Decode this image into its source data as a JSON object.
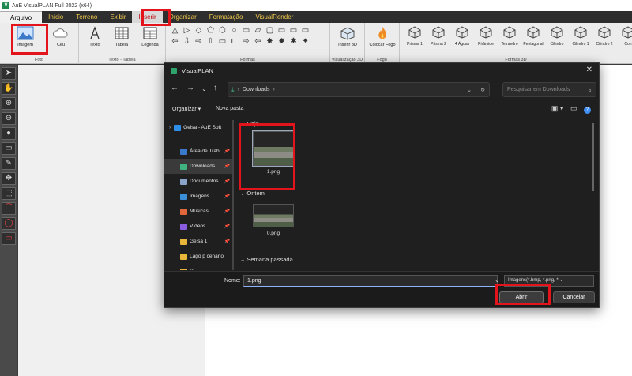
{
  "app": {
    "title": "AuE VisualPLAN Full 2022 (x64)"
  },
  "menu": [
    "Arquivo",
    "Início",
    "Terreno",
    "Exibir",
    "Inserir",
    "Organizar",
    "Formatação",
    "VisualRender"
  ],
  "ribbon": {
    "foto": {
      "imagem": "Imagem",
      "ceu": "Céu",
      "group": "Foto"
    },
    "texto_tabela": {
      "texto": "Texto",
      "tabela": "Tabela",
      "legenda": "Legenda",
      "group": "Texto - Tabela"
    },
    "formas": {
      "group": "Formas",
      "shapes": [
        "△",
        "▷",
        "◇",
        "⬠",
        "⬡",
        "○",
        "▭",
        "▱",
        "▢",
        "▭",
        "▭",
        "▭",
        "⇦",
        "⇩",
        "⇨",
        "⇧",
        "▭",
        "⊏",
        "⇨",
        "⇦",
        "✸",
        "✹",
        "✱",
        "✦"
      ]
    },
    "visualizacao3d": {
      "label": "Inserir 3D",
      "group": "Visualização 3D"
    },
    "fogo": {
      "label": "Colocar Fogo",
      "group": "Fogo"
    },
    "formas3d": {
      "group": "Formas 3D",
      "items": [
        "Prisma 1",
        "Prisma 2",
        "4 Águas",
        "Pirâmide",
        "Tetraedro",
        "Pentagonal",
        "Cilindro",
        "Cilindro 1",
        "Cilindro 2",
        "Con"
      ]
    }
  },
  "dialog": {
    "title": "VisualPLAN",
    "breadcrumb": "Downloads",
    "search_placeholder": "Pesquisar em Downloads",
    "organizar": "Organizar",
    "nova_pasta": "Nova pasta",
    "sidebar": [
      {
        "label": "Geisa - AuE Soft",
        "color": "#2f8fe8",
        "pinned": false,
        "top": true
      },
      {
        "label": "Área de Trab",
        "color": "#3a78c8",
        "pinned": true
      },
      {
        "label": "Downloads",
        "color": "#3fb27f",
        "pinned": true,
        "selected": true
      },
      {
        "label": "Documentos",
        "color": "#8aa3c8",
        "pinned": true
      },
      {
        "label": "Imagens",
        "color": "#3a8fd8",
        "pinned": true
      },
      {
        "label": "Músicas",
        "color": "#e0663c",
        "pinned": true
      },
      {
        "label": "Vídeos",
        "color": "#8a5ce0",
        "pinned": true
      },
      {
        "label": "Geisa 1",
        "color": "#e8b73a",
        "pinned": true
      },
      {
        "label": "Lago p cenario",
        "color": "#e8b73a",
        "pinned": false
      },
      {
        "label": "C...",
        "color": "#e8b73a",
        "pinned": false
      }
    ],
    "sections": {
      "hoje": "Hoje",
      "ontem": "Ontem",
      "semana": "Semana passada"
    },
    "files": {
      "hoje": "1.png",
      "ontem": "0.png"
    },
    "name_label": "Nome:",
    "name_value": "1.png",
    "filter_value": "Imagens(*.bmp, *.png, *",
    "open": "Abrir",
    "cancel": "Cancelar"
  }
}
